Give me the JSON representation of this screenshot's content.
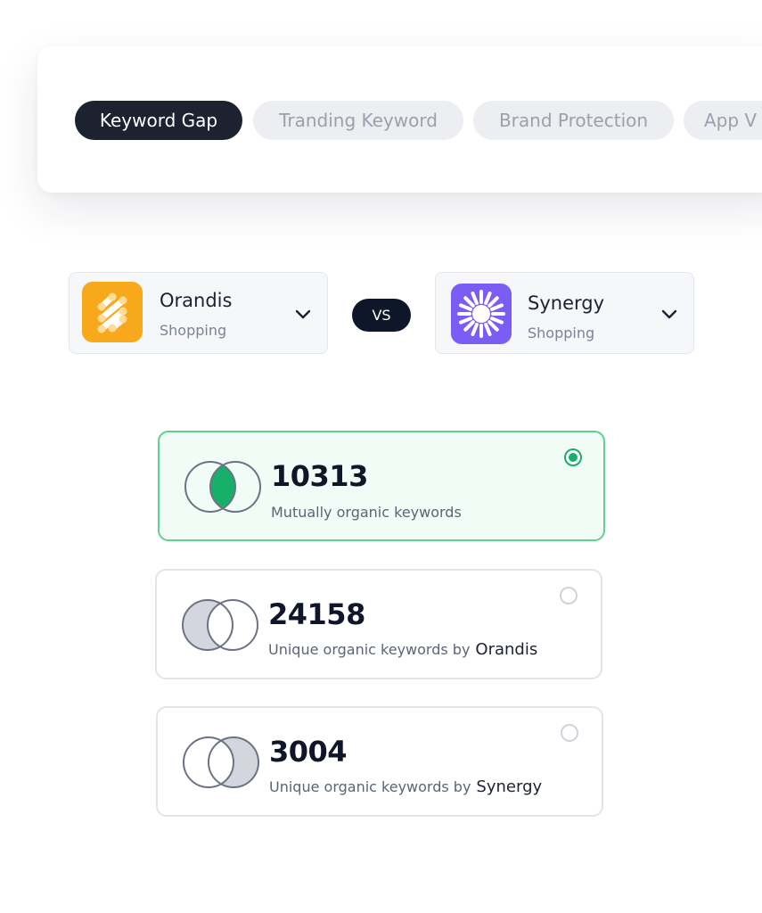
{
  "tabs": [
    {
      "label": "Keyword Gap",
      "active": true
    },
    {
      "label": "Tranding Keyword",
      "active": false
    },
    {
      "label": "Brand Protection",
      "active": false
    },
    {
      "label": "App V",
      "active": false
    }
  ],
  "compare": {
    "left": {
      "name": "Orandis",
      "category": "Shopping",
      "icon": "orandis-logo-icon",
      "color": "#f7a81b"
    },
    "vs_label": "VS",
    "right": {
      "name": "Synergy",
      "category": "Shopping",
      "icon": "synergy-logo-icon",
      "color": "#7b5cf5"
    }
  },
  "options": [
    {
      "value": "10313",
      "label": "Mutually organic keywords",
      "app": "",
      "selected": true
    },
    {
      "value": "24158",
      "label": "Unique organic keywords by",
      "app": "Orandis",
      "selected": false
    },
    {
      "value": "3004",
      "label": "Unique organic keywords by",
      "app": "Synergy",
      "selected": false
    }
  ],
  "colors": {
    "accent_green": "#16b06a",
    "dark": "#1c2230"
  }
}
